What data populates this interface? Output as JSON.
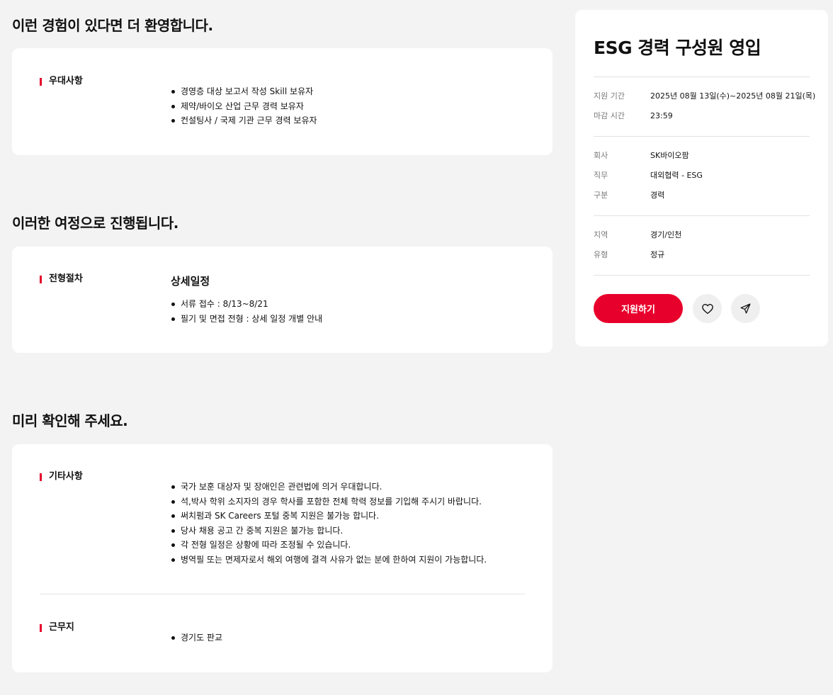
{
  "sections": {
    "preferred": {
      "title": "이런 경험이 있다면 더 환영합니다.",
      "label": "우대사항",
      "items": [
        "경영층 대상 보고서 작성 Skill 보유자",
        "제약/바이오 산업 근무 경력 보유자",
        "컨설팅사 / 국제 기관 근무 경력 보유자"
      ]
    },
    "process": {
      "title": "이러한 여정으로 진행됩니다.",
      "label": "전형절차",
      "sub_heading": "상세일정",
      "items": [
        "서류 접수 : 8/13~8/21",
        "필기 및 면접 전형 : 상세 일정 개별 안내"
      ]
    },
    "notice": {
      "title": "미리 확인해 주세요.",
      "etc_label": "기타사항",
      "etc_items": [
        "국가 보훈 대상자 및 장애인은 관련법에 의거 우대합니다.",
        "석,박사 학위 소지자의 경우 학사를 포함한 전체 학력 정보를 기입해 주시기 바랍니다.",
        "써치펌과 SK Careers 포털 중복 지원은 불가능 합니다.",
        "당사 채용 공고 간 중복 지원은 불가능 합니다.",
        "각 전형 일정은 상황에 따라 조정될 수 있습니다.",
        "병역필 또는 면제자로서 해외 여행에 결격 사유가 없는 분에 한하여 지원이 가능합니다."
      ],
      "location_label": "근무지",
      "location_items": [
        "경기도 판교"
      ]
    }
  },
  "sidebar": {
    "title": "ESG 경력 구성원 영입",
    "period_label": "지원 기간",
    "period_value": "2025년 08월 13일(수)~2025년 08월 21일(목)",
    "deadline_label": "마감 시간",
    "deadline_value": "23:59",
    "company_label": "회사",
    "company_value": "SK바이오팜",
    "job_label": "직무",
    "job_value": "대외협력 - ESG",
    "category_label": "구분",
    "category_value": "경력",
    "region_label": "지역",
    "region_value": "경기/인천",
    "type_label": "유형",
    "type_value": "정규",
    "apply_label": "지원하기"
  },
  "colors": {
    "accent": "#e8002c",
    "background": "#f3f3f3",
    "card": "#ffffff"
  },
  "icons": {
    "like": "heart-icon",
    "share": "send-icon"
  }
}
